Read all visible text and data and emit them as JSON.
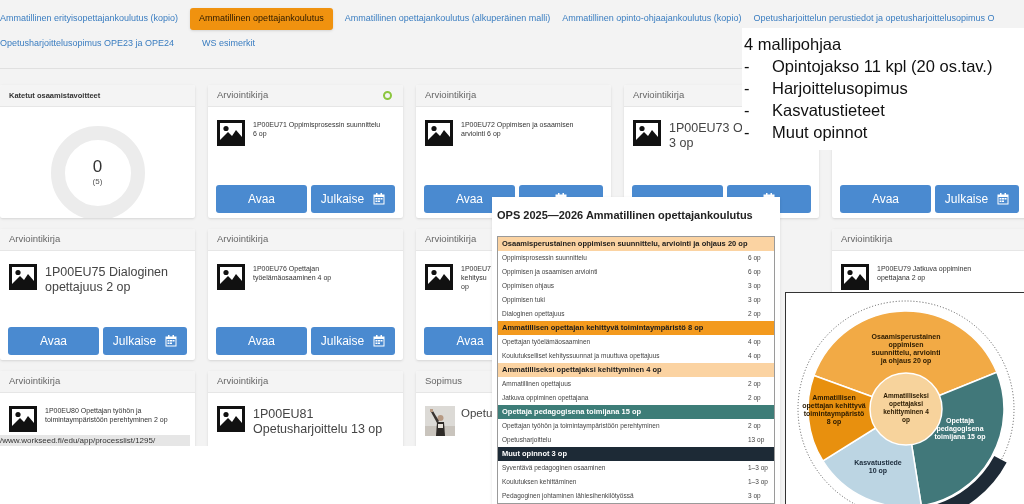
{
  "tab_rows": [
    [
      {
        "label": "Ammatillinen erityisopettajankoulutus (kopio)",
        "selected": false
      },
      {
        "label": "Ammatillinen opettajankoulutus",
        "selected": true
      },
      {
        "label": "Ammatillinen opettajankoulutus (alkuperäinen malli)",
        "selected": false
      },
      {
        "label": "Ammatillinen opinto-ohjaajankoulutus (kopio)",
        "selected": false
      },
      {
        "label": "Opetusharjoittelun perustiedot ja opetusharjoittelusopimus O",
        "selected": false
      }
    ],
    [
      {
        "label": "Opetusharjoittelusopimus OPE23 ja OPE24",
        "selected": false
      },
      {
        "label": "WS esimerkit",
        "selected": false
      }
    ]
  ],
  "cards": [
    {
      "kind": "progress",
      "header": "Katetut osaamistavoitteet",
      "value": "0",
      "total": "(5)",
      "level": 0
    },
    {
      "kind": "assessment",
      "header": "Arviointikirja",
      "indicator": true,
      "image": true,
      "title_lines": [
        "1P00EU71 Oppimisprosessin suunnittelu",
        "6 op"
      ],
      "large_title": false,
      "buttons": [
        {
          "label": "Avaa",
          "calendar": false
        },
        {
          "label": "Julkaise",
          "calendar": true
        }
      ]
    },
    {
      "kind": "assessment",
      "header": "Arviointikirja",
      "indicator": false,
      "image": true,
      "title_lines": [
        "1P00EU72 Oppimisen ja osaamisen",
        "arviointi 6 op"
      ],
      "large_title": false,
      "buttons": [
        {
          "label": "Avaa",
          "calendar": false
        },
        {
          "calendar": true
        }
      ]
    },
    {
      "kind": "assessment",
      "header": "Arviointikirja",
      "indicator": false,
      "image": true,
      "title_lines": [
        "1P00EU73 O",
        "3 op"
      ],
      "large_title": true,
      "buttons": [
        {
          "calendar": false
        },
        {
          "calendar": true
        }
      ]
    },
    {
      "kind": "assessment",
      "indicator": false,
      "buttons": [
        {
          "label": "Avaa",
          "calendar": false
        },
        {
          "label": "Julkaise",
          "calendar": true
        }
      ]
    },
    {
      "kind": "assessment",
      "header": "Arviointikirja",
      "indicator": false,
      "image": true,
      "title_lines": [
        "1P00EU75 Dialoginen",
        "opettajuus 2 op"
      ],
      "large_title": true,
      "buttons": [
        {
          "label": "Avaa",
          "calendar": false
        },
        {
          "label": "Julkaise",
          "calendar": true
        }
      ]
    },
    {
      "kind": "assessment",
      "header": "Arviointikirja",
      "indicator": false,
      "image": true,
      "title_lines": [
        "1P00EU76 Opettajan",
        "työelämäosaaminen 4 op"
      ],
      "large_title": false,
      "buttons": [
        {
          "label": "Avaa",
          "calendar": false
        },
        {
          "label": "Julkaise",
          "calendar": true
        }
      ]
    },
    {
      "kind": "assessment",
      "header": "Arviointikirja",
      "indicator": false,
      "image": true,
      "title_lines": [
        "1P00EU7",
        "kehitysu",
        "op"
      ],
      "large_title": false,
      "buttons": [
        {
          "label": "Avaa",
          "calendar": false
        }
      ]
    },
    {
      "kind": "blank"
    },
    {
      "kind": "assessment",
      "header": "Arviointikirja",
      "indicator": false,
      "image": true,
      "title_lines": [
        "1P00EU79 Jatkuva oppiminen",
        "opettajana 2 op"
      ],
      "large_title": false
    },
    {
      "kind": "assessment",
      "header": "Arviointikirja",
      "indicator": false,
      "image": true,
      "title_lines": [
        "1P00EU80 Opettajan työhön ja",
        "toimintaympäristöön perehtyminen 2 op"
      ],
      "large_title": false
    },
    {
      "kind": "assessment",
      "header": "Arviointikirja",
      "indicator": false,
      "image": true,
      "title_lines": [
        "1P00EU81",
        "Opetusharjoittelu 13 op"
      ],
      "large_title": true
    },
    {
      "kind": "contract",
      "header": "Sopimus",
      "indicator": false,
      "title_lines": [
        "Opetu"
      ],
      "large_title": true
    },
    {
      "kind": "blank"
    },
    {
      "kind": "blank"
    }
  ],
  "link_tooltip": "/www.workseed.fi/edu/app/processlist/1295/",
  "note": {
    "title": "4 mallipohjaa",
    "items": [
      {
        "marker": "-",
        "text": "Opintojakso 11 kpl (20 os.tav.)"
      },
      {
        "marker": "-",
        "text": "Harjoittelusopimus"
      },
      {
        "marker": "-",
        "text": "Kasvatustieteet"
      },
      {
        "marker": "-",
        "text": "Muut opinnot"
      }
    ]
  },
  "curriculum": {
    "title": "OPS 2025—2026 Ammatillinen opettajankoulutus",
    "sections": [
      {
        "heading": "Osaamisperustainen oppimisen suunnittelu, arviointi ja ohjaus 20 op",
        "color": "#fbd3a2",
        "rows": [
          {
            "name": "Oppimisprosessin suunnittelu",
            "credits": "6 op"
          },
          {
            "name": "Oppimisen ja osaamisen arviointi",
            "credits": "6 op"
          },
          {
            "name": "Oppimisen ohjaus",
            "credits": "3 op"
          },
          {
            "name": "Oppimisen tuki",
            "credits": "3 op"
          },
          {
            "name": "Dialoginen opettajuus",
            "credits": "2 op"
          }
        ]
      },
      {
        "heading": "Ammatillisen opettajan kehittyvä toimintaympäristö 8 op",
        "color": "#f39a1e",
        "rows": [
          {
            "name": "Opettajan työelämäosaaminen",
            "credits": "4 op"
          },
          {
            "name": "Koulutukselliset kehityssuunnat ja muuttuva opettajuus",
            "credits": "4 op"
          }
        ]
      },
      {
        "heading": "Ammatilliseksi opettajaksi kehittyminen 4 op",
        "color": "#fbd3a2",
        "rows": [
          {
            "name": "Ammatillinen opettajuus",
            "credits": "2 op"
          },
          {
            "name": "Jatkuva oppiminen opettajana",
            "credits": "2 op"
          }
        ]
      },
      {
        "heading": "Opettaja pedagogisena toimijana 15 op",
        "color": "#3d7d78",
        "rows": [
          {
            "name": "Opettajan työhön ja toimintaympäristöön perehtyminen",
            "credits": "2 op"
          },
          {
            "name": "Opetusharjoittelu",
            "credits": "13 op"
          }
        ]
      },
      {
        "heading": "Muut opinnot 3 op",
        "color": "#1d2a36",
        "rows": [
          {
            "name": "Syventävä pedagoginen osaaminen",
            "credits": "1–3 op"
          },
          {
            "name": "Koulutuksen kehittäminen",
            "credits": "1–3 op"
          },
          {
            "name": "Pedagoginen johtaminen lähiesihenkilötyössä",
            "credits": "3 op"
          }
        ]
      }
    ]
  },
  "wheel": {
    "segments": [
      {
        "label": "Osaamisperustainen oppimisen suunnittelu, arviointi ja ohjaus 20 op",
        "color": "#f2aa45"
      },
      {
        "label": "Opettaja pedagogisena toimijana 15 op",
        "color": "#41787a"
      },
      {
        "label": "Kasvatustiede 10 op",
        "color": "#bcd5e3"
      },
      {
        "label": "Ammatillisen opettajan kehittyvä toimintaympäristö 8 op",
        "color": "#e8900e"
      }
    ],
    "center": {
      "label": "Ammatilliseksi opettajaksi kehittyminen 4 op",
      "color": "#f7d39c"
    }
  }
}
